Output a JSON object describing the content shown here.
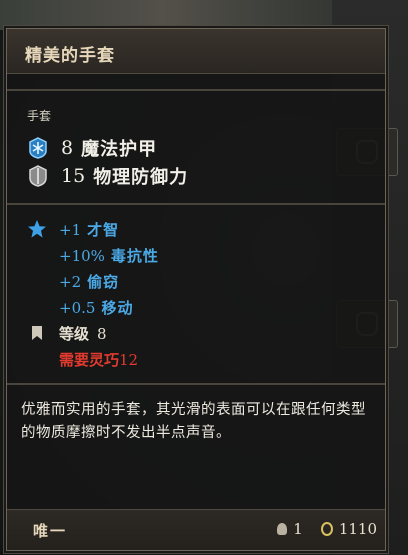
{
  "item": {
    "name": "精美的手套",
    "type": "手套",
    "stats": [
      {
        "value": "8",
        "label": "魔法护甲",
        "icon": "snowflake-armor-icon"
      },
      {
        "value": "15",
        "label": "物理防御力",
        "icon": "shield-icon"
      }
    ],
    "attributes": [
      {
        "value": "+1",
        "label": "才智"
      },
      {
        "value": "+10%",
        "label": "毒抗性"
      },
      {
        "value": "+2",
        "label": "偷窃"
      },
      {
        "value": "+0.5",
        "label": "移动"
      }
    ],
    "level_label": "等级",
    "level_value": "8",
    "requirement_label": "需要灵巧",
    "requirement_value": "12",
    "description": "优雅而实用的手套，其光滑的表面可以在跟任何类型的物质摩擦时不发出半点声音。",
    "rarity": "唯一",
    "weight": "1",
    "value": "1110"
  },
  "colors": {
    "attribute": "#4ba9e6",
    "requirement": "#e23a2f",
    "title": "#e6d7ba"
  }
}
